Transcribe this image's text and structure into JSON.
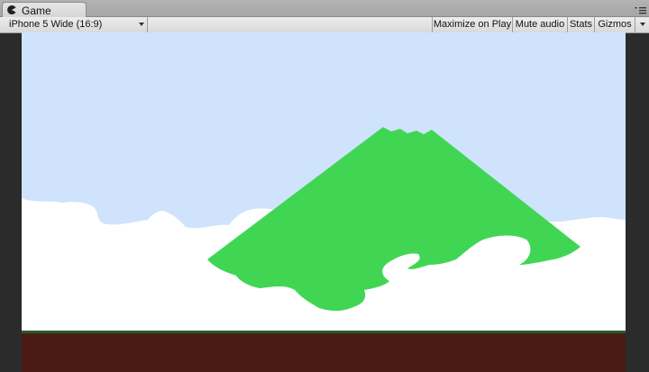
{
  "tab": {
    "label": "Game",
    "icon": "pacman-icon",
    "menu_icon": "panel-menu-icon"
  },
  "toolbar": {
    "aspect_label": "iPhone 5 Wide (16:9)",
    "maximize_label": "Maximize on Play",
    "mute_label": "Mute audio",
    "stats_label": "Stats",
    "gizmos_label": "Gizmos"
  },
  "scene": {
    "sky_color": "#cfe3fc",
    "cloud_color": "#ffffff",
    "mountain_color": "#40d654",
    "ground_color": "#4a1b14",
    "grass_strip_color": "#2b5c28",
    "background_color": "#2b2b2b"
  }
}
